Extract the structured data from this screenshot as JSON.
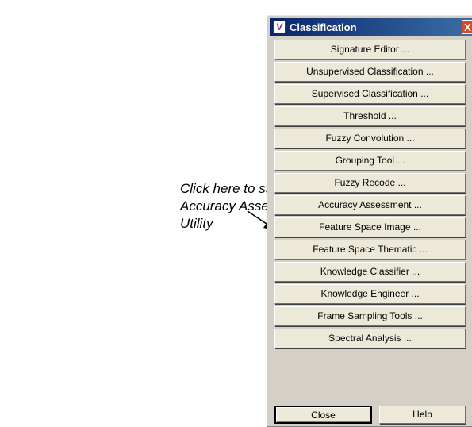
{
  "annotation": {
    "lines": [
      "Click here to start the",
      "Accuracy Assessment",
      "Utility"
    ]
  },
  "window": {
    "title": "Classification",
    "icon": "app-logo-icon",
    "close_glyph": "X",
    "buttons": [
      "Signature Editor ...",
      "Unsupervised Classification ...",
      "Supervised Classification ...",
      "Threshold ...",
      "Fuzzy Convolution ...",
      "Grouping Tool ...",
      "Fuzzy Recode ...",
      "Accuracy Assessment ...",
      "Feature Space Image ...",
      "Feature Space Thematic ...",
      "Knowledge Classifier ...",
      "Knowledge Engineer ...",
      "Frame Sampling Tools ...",
      "Spectral Analysis ..."
    ],
    "footer": {
      "close_label": "Close",
      "help_label": "Help"
    }
  },
  "colors": {
    "titlebar_start": "#0a246a",
    "titlebar_end": "#3a6ea5",
    "button_face": "#ece9d8",
    "window_bg": "#d4d0c8"
  }
}
